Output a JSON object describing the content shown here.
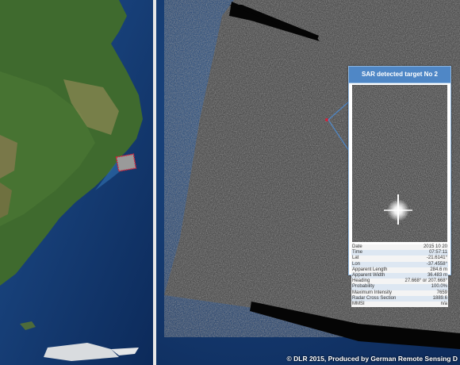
{
  "popup": {
    "title": "SAR detected target No 2",
    "rows": [
      {
        "label": "Date",
        "value": "2015 10 20"
      },
      {
        "label": "Time",
        "value": "07:57:11"
      },
      {
        "label": "Lat",
        "value": "-21.6141°"
      },
      {
        "label": "Lon",
        "value": "-37.4558°"
      },
      {
        "label": "Apparent Length",
        "value": "284.6 m"
      },
      {
        "label": "Apparent Width",
        "value": "36.483 m"
      },
      {
        "label": "Heading",
        "value": "27.668° or 207.668°"
      },
      {
        "label": "Probability",
        "value": "100.0%"
      },
      {
        "label": "Maximum Intensity",
        "value": "7659"
      },
      {
        "label": "Radar Cross Section",
        "value": "1889.6"
      },
      {
        "label": "MMSI",
        "value": "n/a"
      }
    ]
  },
  "credit": "© DLR 2015, Produced by German Remote Sensing D",
  "colors": {
    "ocean": "#12366b",
    "land": "#3f6a2e",
    "sar": "#3a3a3a",
    "popup_header": "#4f87c6",
    "marker": "#d0243a"
  }
}
